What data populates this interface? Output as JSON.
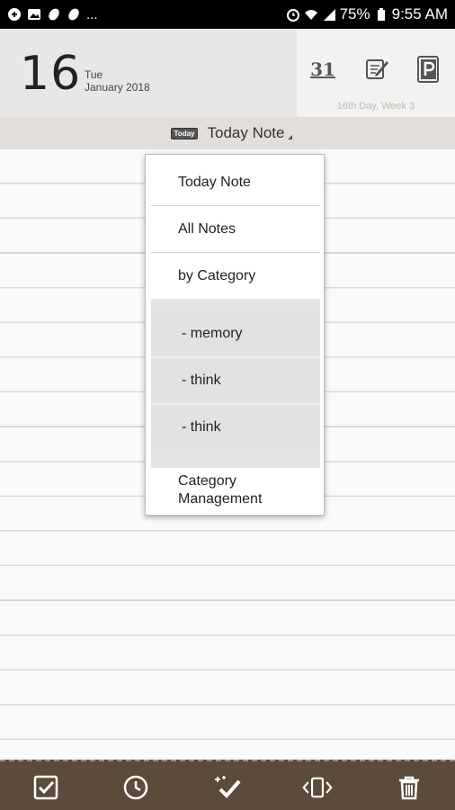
{
  "status_bar": {
    "battery": "75%",
    "time": "9:55 AM",
    "more": "..."
  },
  "header": {
    "day": "16",
    "weekday": "Tue",
    "month_year": "January 2018",
    "calendar_icon_label": "31",
    "day_info": "16th Day, Week 3"
  },
  "titlebar": {
    "badge": "Today",
    "title": "Today Note"
  },
  "menu": {
    "items": [
      {
        "label": "Today Note"
      },
      {
        "label": "All Notes"
      },
      {
        "label": "by Category"
      }
    ],
    "categories": [
      {
        "label": "- memory"
      },
      {
        "label": "- think"
      },
      {
        "label": "- think"
      }
    ],
    "management_line1": "Category",
    "management_line2": "Management"
  },
  "toolbar": {
    "icons": [
      "checkbox-icon",
      "clock-icon",
      "magic-check-icon",
      "swap-page-icon",
      "trash-icon"
    ]
  },
  "colors": {
    "toolbar_bg": "#5b4b3b",
    "header_bg": "#e8e7e5",
    "titlebar_bg": "#e2dfdb"
  }
}
